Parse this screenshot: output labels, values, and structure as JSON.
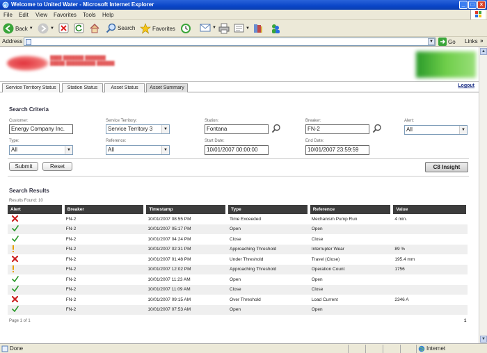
{
  "window": {
    "title": "Welcome to United Water - Microsoft Internet Explorer"
  },
  "menu": [
    "File",
    "Edit",
    "View",
    "Favorites",
    "Tools",
    "Help"
  ],
  "toolbar": {
    "back": "Back",
    "search": "Search",
    "favorites": "Favorites"
  },
  "address": {
    "label": "Address",
    "go": "Go",
    "links": "Links"
  },
  "tabs": [
    "Service Territory Status",
    "Station Status",
    "Asset Status",
    "Asset Summary"
  ],
  "logout": "Logout",
  "criteria": {
    "title": "Search Criteria",
    "customer": {
      "label": "Customer:",
      "value": "Energy Company Inc."
    },
    "territory": {
      "label": "Service Territory:",
      "value": "Service Territory 3"
    },
    "station": {
      "label": "Station:",
      "value": "Fontana"
    },
    "breaker": {
      "label": "Breaker:",
      "value": "FN-2"
    },
    "alert": {
      "label": "Alert:",
      "value": "All"
    },
    "type": {
      "label": "Type:",
      "value": "All"
    },
    "reference": {
      "label": "Reference:",
      "value": "All"
    },
    "start": {
      "label": "Start Date:",
      "value": "10/01/2007 00:00:00"
    },
    "end": {
      "label": "End Date:",
      "value": "10/01/2007 23:59:59"
    },
    "submit": "Submit",
    "reset": "Reset",
    "insight": "C8 Insight"
  },
  "results": {
    "title": "Search Results",
    "count": "Results Found: 10",
    "columns": [
      "Alert",
      "Breaker",
      "Timestamp",
      "Type",
      "Reference",
      "Value"
    ],
    "rows": [
      {
        "alert": "x",
        "breaker": "FN-2",
        "timestamp": "10/01/2007 08:55 PM",
        "type": "Time Exceeded",
        "reference": "Mechanism Pump Run",
        "value": "4 min."
      },
      {
        "alert": "check",
        "breaker": "FN-2",
        "timestamp": "10/01/2007 05:17 PM",
        "type": "Open",
        "reference": "Open",
        "value": ""
      },
      {
        "alert": "check",
        "breaker": "FN-2",
        "timestamp": "10/01/2007 04:24 PM",
        "type": "Close",
        "reference": "Close",
        "value": ""
      },
      {
        "alert": "warn",
        "breaker": "FN-2",
        "timestamp": "10/01/2007 02:31 PM",
        "type": "Approaching Threshold",
        "reference": "Interrupter Wear",
        "value": "89 %"
      },
      {
        "alert": "x",
        "breaker": "FN-2",
        "timestamp": "10/01/2007 01:48 PM",
        "type": "Under Threshold",
        "reference": "Travel (Close)",
        "value": "195.4 mm"
      },
      {
        "alert": "warn",
        "breaker": "FN-2",
        "timestamp": "10/01/2007 12:02 PM",
        "type": "Approaching Threshold",
        "reference": "Operation Count",
        "value": "1756"
      },
      {
        "alert": "check",
        "breaker": "FN-2",
        "timestamp": "10/01/2007 11:23 AM",
        "type": "Open",
        "reference": "Open",
        "value": ""
      },
      {
        "alert": "check",
        "breaker": "FN-2",
        "timestamp": "10/01/2007 11:09 AM",
        "type": "Close",
        "reference": "Close",
        "value": ""
      },
      {
        "alert": "x",
        "breaker": "FN-2",
        "timestamp": "10/01/2007 09:15 AM",
        "type": "Over Threshold",
        "reference": "Load Current",
        "value": "2346 A"
      },
      {
        "alert": "check",
        "breaker": "FN-2",
        "timestamp": "10/01/2007 07:53 AM",
        "type": "Open",
        "reference": "Open",
        "value": ""
      }
    ],
    "page_info": "Page 1 of 1",
    "page_number": "1"
  },
  "status": {
    "text": "Done",
    "zone": "Internet"
  },
  "colors": {
    "title_bar": "#0a46c8",
    "header_row": "#3c3c3c",
    "x_icon": "#cc2222",
    "check_icon": "#2a9a2a",
    "warn_icon": "#e8a000"
  }
}
